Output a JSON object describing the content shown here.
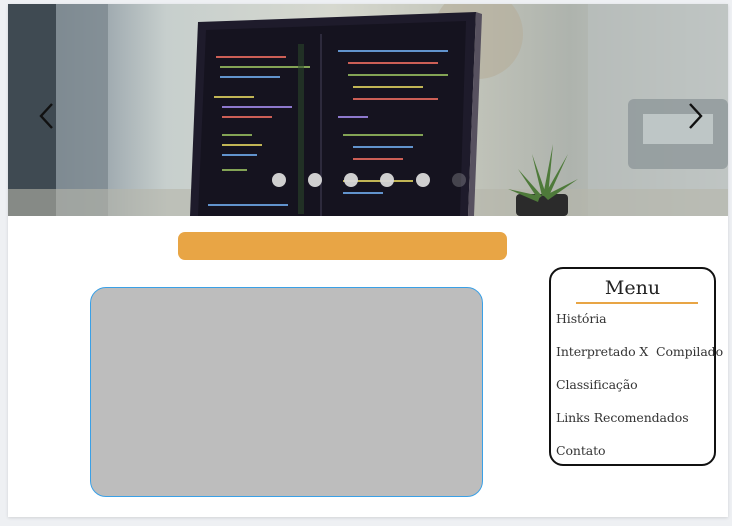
{
  "carousel": {
    "prev_icon": "chevron-left-icon",
    "next_icon": "chevron-right-icon",
    "slide_count": 6,
    "active_dot_color": "#d9d9d9"
  },
  "title_bar": {
    "color": "#e8a545"
  },
  "content_box": {
    "background": "#bdbdbd",
    "border_color": "#3aa0e6"
  },
  "menu": {
    "title": "Menu",
    "items": [
      {
        "label": "História"
      },
      {
        "label": "Interpretado X  Compilado"
      },
      {
        "label": "Classificação"
      },
      {
        "label": "Links Recomendados"
      },
      {
        "label": "Contato"
      }
    ]
  }
}
